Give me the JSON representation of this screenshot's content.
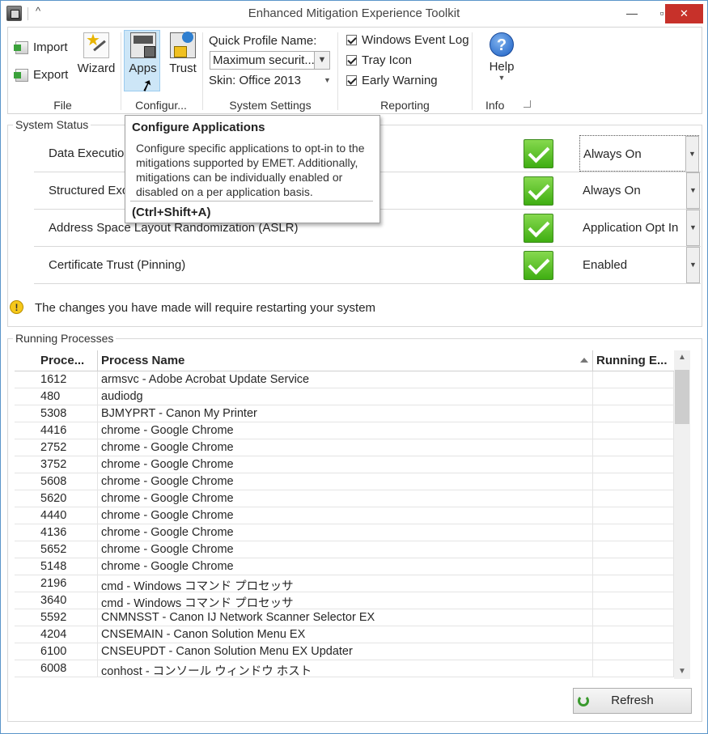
{
  "window": {
    "title": "Enhanced Mitigation Experience Toolkit"
  },
  "ribbon": {
    "file": {
      "label": "File",
      "import": "Import",
      "export": "Export",
      "wizard": "Wizard"
    },
    "configure": {
      "label": "Configur...",
      "apps": "Apps",
      "trust": "Trust"
    },
    "system_settings": {
      "label": "System Settings",
      "quick_profile_label": "Quick Profile Name:",
      "quick_profile_value": "Maximum securit...",
      "skin": "Skin: Office 2013"
    },
    "reporting": {
      "label": "Reporting",
      "windows_event_log": "Windows Event Log",
      "tray_icon": "Tray Icon",
      "early_warning": "Early Warning"
    },
    "info": {
      "label": "Info",
      "help": "Help"
    }
  },
  "tooltip": {
    "title": "Configure Applications",
    "body": "Configure specific applications to opt-in to the mitigations supported by EMET. Additionally, mitigations can be individually enabled or disabled on a per application basis.",
    "shortcut": "(Ctrl+Shift+A)"
  },
  "system_status": {
    "legend": "System Status",
    "rows": [
      {
        "label": "Data Execution Prevention (DEP)",
        "value": "Always On"
      },
      {
        "label": "Structured Exception Handler Overwrite Protection (SEHOP)",
        "value": "Always On"
      },
      {
        "label": "Address Space Layout Randomization (ASLR)",
        "value": "Application Opt In"
      },
      {
        "label": "Certificate Trust (Pinning)",
        "value": "Enabled"
      }
    ],
    "warning": "The changes you have made will require restarting your system"
  },
  "processes": {
    "legend": "Running Processes",
    "columns": {
      "pid": "Proce...",
      "name": "Process Name",
      "running": "Running E..."
    },
    "rows": [
      {
        "pid": "1612",
        "name": "armsvc - Adobe Acrobat Update Service"
      },
      {
        "pid": "480",
        "name": "audiodg"
      },
      {
        "pid": "5308",
        "name": "BJMYPRT - Canon My Printer"
      },
      {
        "pid": "4416",
        "name": "chrome - Google Chrome"
      },
      {
        "pid": "2752",
        "name": "chrome - Google Chrome"
      },
      {
        "pid": "3752",
        "name": "chrome - Google Chrome"
      },
      {
        "pid": "5608",
        "name": "chrome - Google Chrome"
      },
      {
        "pid": "5620",
        "name": "chrome - Google Chrome"
      },
      {
        "pid": "4440",
        "name": "chrome - Google Chrome"
      },
      {
        "pid": "4136",
        "name": "chrome - Google Chrome"
      },
      {
        "pid": "5652",
        "name": "chrome - Google Chrome"
      },
      {
        "pid": "5148",
        "name": "chrome - Google Chrome"
      },
      {
        "pid": "2196",
        "name": "cmd - Windows コマンド プロセッサ"
      },
      {
        "pid": "3640",
        "name": "cmd - Windows コマンド プロセッサ"
      },
      {
        "pid": "5592",
        "name": "CNMNSST - Canon IJ Network Scanner Selector EX"
      },
      {
        "pid": "4204",
        "name": "CNSEMAIN - Canon Solution Menu EX"
      },
      {
        "pid": "6100",
        "name": "CNSEUPDT - Canon Solution Menu EX Updater"
      },
      {
        "pid": "6008",
        "name": "conhost - コンソール ウィンドウ ホスト"
      }
    ]
  },
  "refresh": {
    "label": "Refresh"
  },
  "colors": {
    "accent": "#5b95c9",
    "close": "#c7312a",
    "check": "#3fae12",
    "hover": "#cde6f7"
  }
}
